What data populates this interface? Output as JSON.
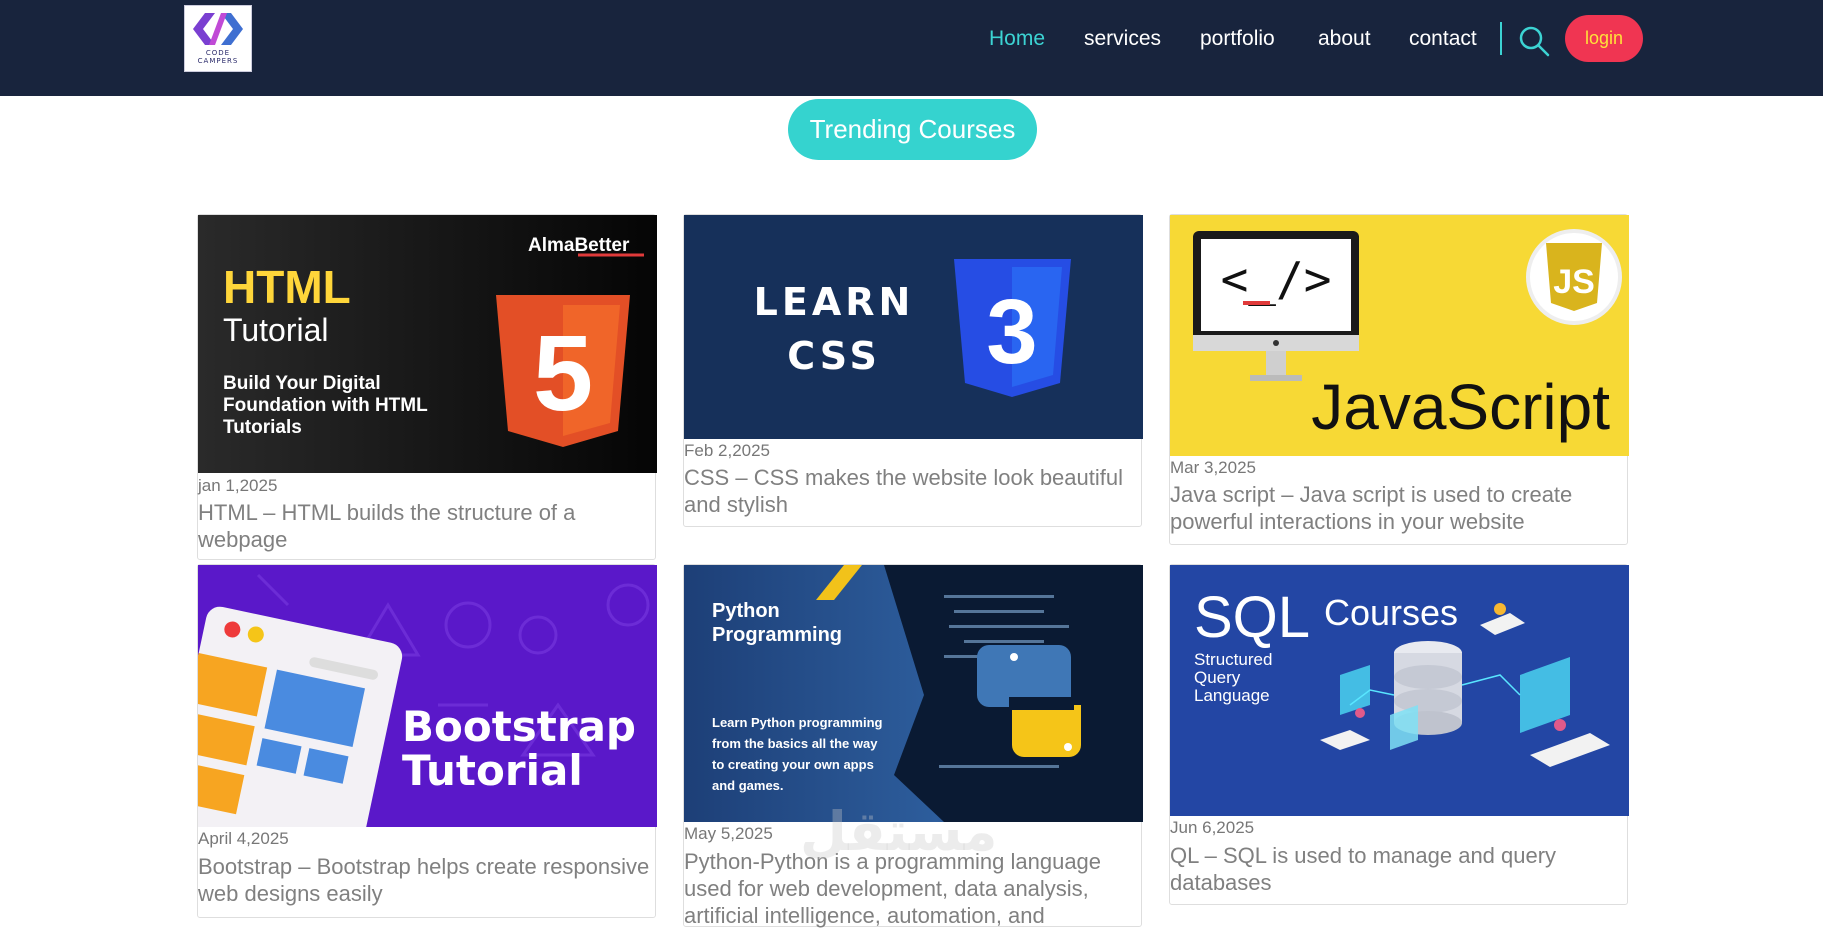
{
  "brand": {
    "logo_text_1": "CODE",
    "logo_text_2": "CAMPERS"
  },
  "nav": {
    "items": [
      "Home",
      "services",
      "portfolio",
      "about",
      "contact"
    ],
    "login": "login"
  },
  "section": {
    "title": "Trending Courses"
  },
  "colors": {
    "nav_bg": "#18243d",
    "accent": "#35d3cf",
    "login_bg": "#f03552",
    "login_text": "#ffe13a"
  },
  "courses": [
    {
      "date": "jan 1,2025",
      "title": "HTML – HTML builds the structure of a webpage",
      "thumb": {
        "brand": "AlmaBetter",
        "heading": "HTML",
        "sub": "Tutorial",
        "line1": "Build Your Digital",
        "line2": "Foundation with HTML",
        "line3": "Tutorials",
        "badge": "5"
      }
    },
    {
      "date": "Feb 2,2025",
      "title": "CSS – CSS makes the website look beautiful and stylish",
      "thumb": {
        "line1": "LEARN",
        "line2": "CSS",
        "badge": "3"
      }
    },
    {
      "date": "Mar 3,2025",
      "title": "Java script – Java script is used to create powerful interactions in your website",
      "thumb": {
        "heading": "JavaScript",
        "code": "<_/>",
        "badge": "JS"
      }
    },
    {
      "date": "April 4,2025",
      "title": "Bootstrap – Bootstrap helps create responsive web designs easily",
      "thumb": {
        "line1": "Bootstrap",
        "line2": "Tutorial"
      }
    },
    {
      "date": "May 5,2025",
      "title": "Python-Python is a programming language used for web development, data analysis, artificial intelligence, automation, and",
      "thumb": {
        "line1": "Python",
        "line2": "Programming",
        "d1": "Learn Python programming",
        "d2": "from the basics all the way",
        "d3": "to creating your own apps",
        "d4": "and games."
      }
    },
    {
      "date": "Jun 6,2025",
      "title": "QL – SQL is used to manage and query databases",
      "thumb": {
        "heading": "SQL",
        "sub": "Courses",
        "l1": "Structured",
        "l2": "Query",
        "l3": "Language"
      }
    }
  ],
  "watermark": "مستقل"
}
